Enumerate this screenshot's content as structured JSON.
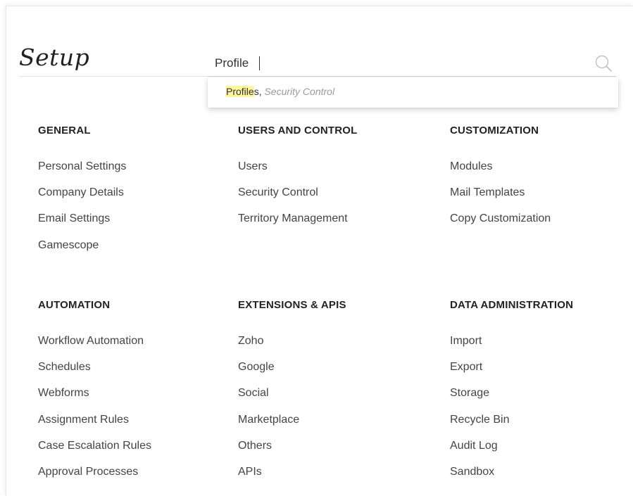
{
  "header": {
    "title": "Setup"
  },
  "search": {
    "value": "Profile",
    "icon": "search-icon",
    "suggestion": {
      "match": "Profile",
      "rest": "s",
      "separator": ", ",
      "context": "Security Control"
    }
  },
  "sections": {
    "general": {
      "title": "GENERAL",
      "items": [
        "Personal Settings",
        "Company Details",
        "Email Settings",
        "Gamescope"
      ]
    },
    "users_control": {
      "title": "USERS AND CONTROL",
      "items": [
        "Users",
        "Security Control",
        "Territory Management"
      ]
    },
    "customization": {
      "title": "CUSTOMIZATION",
      "items": [
        "Modules",
        "Mail Templates",
        "Copy Customization"
      ]
    },
    "automation": {
      "title": "AUTOMATION",
      "items": [
        "Workflow Automation",
        "Schedules",
        "Webforms",
        "Assignment Rules",
        "Case Escalation Rules",
        "Approval Processes"
      ]
    },
    "extensions": {
      "title": "EXTENSIONS & APIS",
      "items": [
        "Zoho",
        "Google",
        "Social",
        "Marketplace",
        "Others",
        "APIs"
      ]
    },
    "data_admin": {
      "title": "DATA ADMINISTRATION",
      "items": [
        "Import",
        "Export",
        "Storage",
        "Recycle Bin",
        "Audit Log",
        "Sandbox"
      ]
    }
  }
}
